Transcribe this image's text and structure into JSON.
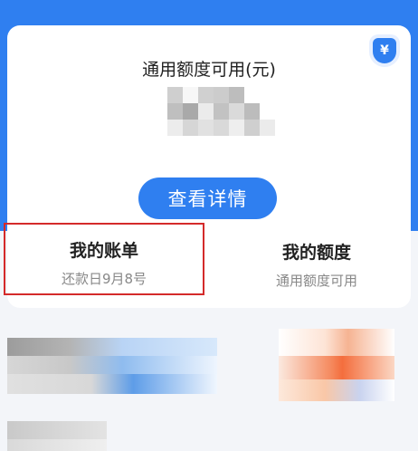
{
  "card": {
    "title": "通用额度可用(元)",
    "shield_symbol": "¥",
    "detail_button": "查看详情"
  },
  "bill": {
    "label": "我的账单",
    "sub": "还款日9月8号"
  },
  "quota": {
    "label": "我的额度",
    "sub": "通用额度可用"
  },
  "colors": {
    "primary": "#2f7ff0",
    "highlight_border": "#d42a2a"
  }
}
